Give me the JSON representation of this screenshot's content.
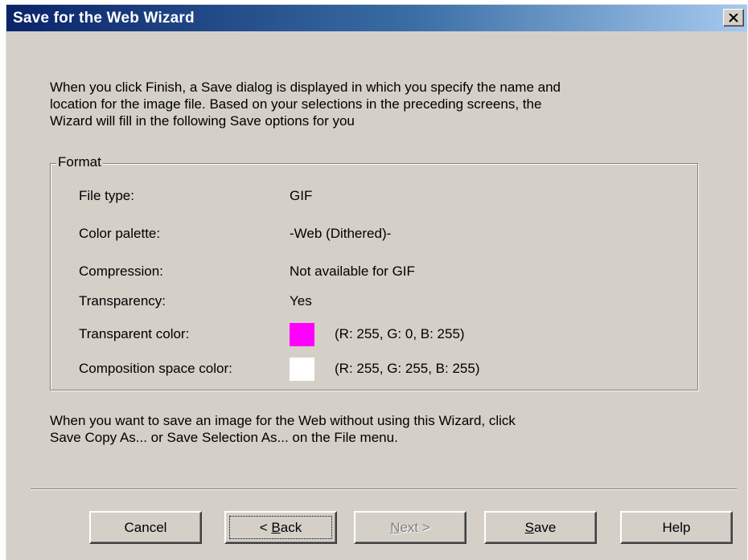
{
  "window": {
    "title": "Save for the Web Wizard",
    "close_symbol": "×"
  },
  "intro_text": "When you click Finish, a Save dialog is displayed in which you specify the name and\nlocation for the image file.  Based on your selections in the preceding screens, the\nWizard will fill in the following Save options for you",
  "format": {
    "legend": "Format",
    "file_type": {
      "label": "File type:",
      "value": "GIF"
    },
    "color_palette": {
      "label": "Color palette:",
      "value": "-Web (Dithered)-"
    },
    "compression": {
      "label": "Compression:",
      "value": "Not available for GIF"
    },
    "transparency": {
      "label": "Transparency:",
      "value": "Yes"
    },
    "transparent_color": {
      "label": "Transparent color:",
      "rgb": "(R: 255, G: 0, B: 255)",
      "color": "#ff00ff"
    },
    "composition_space_color": {
      "label": "Composition space color:",
      "rgb": "(R: 255, G: 255, B: 255)",
      "color": "#ffffff"
    }
  },
  "outro_text": "When you want to save an image for the Web without using this Wizard, click\nSave Copy As... or Save Selection As... on the File menu.",
  "buttons": {
    "cancel": "Cancel",
    "back_prefix": "< ",
    "back_mnemonic": "B",
    "back_rest": "ack",
    "next_mnemonic": "N",
    "next_rest": "ext >",
    "save_mnemonic": "S",
    "save_rest": "ave",
    "help": "Help"
  }
}
